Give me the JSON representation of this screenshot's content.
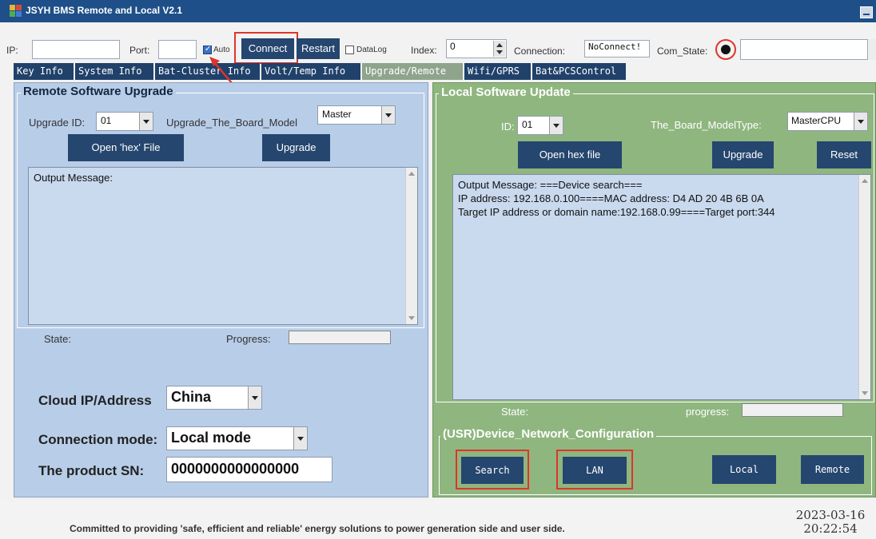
{
  "app": {
    "title": "JSYH BMS Remote and Local V2.1"
  },
  "toolbar": {
    "ip_label": "IP:",
    "ip_value": "",
    "port_label": "Port:",
    "port_value": "",
    "auto_label": "Auto",
    "auto_checked": true,
    "connect_label": "Connect",
    "restart_label": "Restart",
    "datalog_label": "DataLog",
    "datalog_checked": false,
    "index_label": "Index:",
    "index_value": "0",
    "connection_label": "Connection:",
    "connection_value": "NoConnect!",
    "comstate_label": "Com_State:",
    "comstate_value": ""
  },
  "tabs": [
    {
      "label": "Key Info"
    },
    {
      "label": "System Info"
    },
    {
      "label": "Bat-Cluster Info"
    },
    {
      "label": "Volt/Temp Info"
    },
    {
      "label": "Upgrade/Remote",
      "active": true
    },
    {
      "label": "Wifi/GPRS"
    },
    {
      "label": "Bat&PCSControl"
    }
  ],
  "remote": {
    "title": "Remote Software Upgrade",
    "upgrade_id_label": "Upgrade ID:",
    "upgrade_id_value": "01",
    "model_label": "Upgrade_The_Board_Model",
    "model_value": "Master",
    "open_hex_label": "Open 'hex' File",
    "upgrade_label": "Upgrade",
    "output_text": "Output Message:",
    "state_label": "State:",
    "progress_label": "Progress:",
    "cloud_label": "Cloud IP/Address",
    "cloud_value": "China",
    "connmode_label": "Connection mode:",
    "connmode_value": "Local mode",
    "sn_label": "The product SN:",
    "sn_value": "0000000000000000"
  },
  "local": {
    "title": "Local Software Update",
    "id_label": "ID:",
    "id_value": "01",
    "model_label": "The_Board_ModelType:",
    "model_value": "MasterCPU",
    "open_hex_label": "Open hex file",
    "upgrade_label": "Upgrade",
    "reset_label": "Reset",
    "output_lines": [
      "Output Message: ===Device search===",
      "IP address: 192.168.0.100====MAC address: D4 AD 20 4B 6B 0A",
      "Target IP address or domain name:192.168.0.99====Target port:344"
    ],
    "state_label": "State:",
    "progress_label": "progress:",
    "net_title": "(USR)Device_Network_Configuration",
    "search_label": "Search",
    "lan_label": "LAN",
    "local_label": "Local",
    "remote_label": "Remote"
  },
  "footer": {
    "slogan": "Committed to providing 'safe, efficient and reliable' energy solutions to power generation side and user side.",
    "date": "2023-03-16",
    "time": "20:22:54"
  },
  "colors": {
    "titlebar": "#1e4f88",
    "navy": "#25466e",
    "remote_panel": "#b8cde8",
    "local_panel": "#8fb67f",
    "highlight": "#e0342a"
  }
}
